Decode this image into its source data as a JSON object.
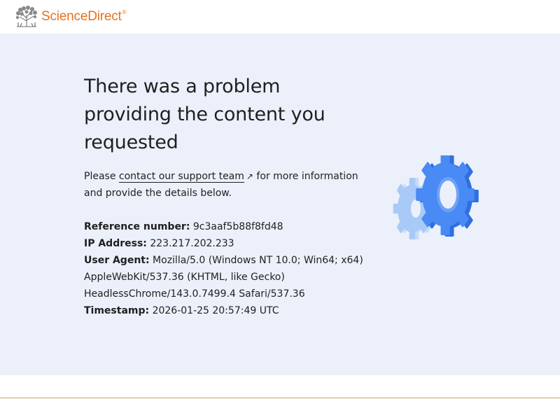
{
  "header": {
    "brand_name": "ScienceDirect",
    "brand_mark": "®",
    "logo_icon": "elsevier-tree-icon",
    "brand_color": "#e9711c"
  },
  "error": {
    "title": "There was a problem providing the content you requested",
    "intro_before_link": "Please ",
    "support_link_text": "contact our support team",
    "support_link_icon": "external-arrow-icon",
    "intro_after_link": " for more information and provide the details below."
  },
  "details": [
    {
      "label": "Reference number:",
      "value": "9c3aaf5b88f8fd48"
    },
    {
      "label": "IP Address:",
      "value": "223.217.202.233"
    },
    {
      "label": "User Agent:",
      "value": "Mozilla/5.0 (Windows NT 10.0; Win64; x64) AppleWebKit/537.36 (KHTML, like Gecko) HeadlessChrome/143.0.7499.4 Safari/537.36"
    },
    {
      "label": "Timestamp:",
      "value": "2026-01-25 20:57:49 UTC"
    }
  ],
  "illustration": {
    "icon": "gears-icon",
    "color_front": "#3b82f0",
    "color_back": "#a9c9f7"
  },
  "colors": {
    "panel_background": "#ebf0fa",
    "footer_rule": "#c8a15c"
  }
}
